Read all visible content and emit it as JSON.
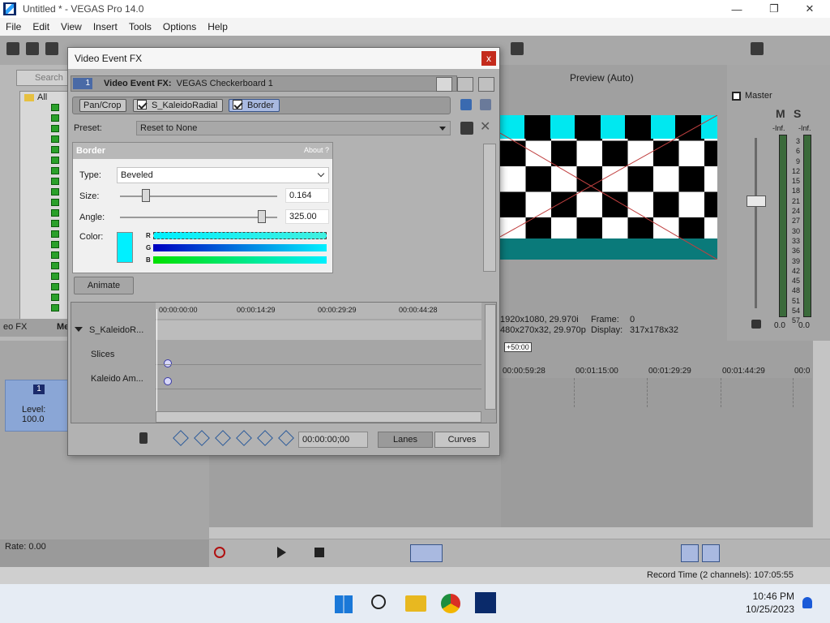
{
  "window": {
    "title": "Untitled * - VEGAS Pro 14.0",
    "minimize": "—",
    "restore": "❐",
    "close": "✕"
  },
  "menu": [
    "File",
    "Edit",
    "View",
    "Insert",
    "Tools",
    "Options",
    "Help"
  ],
  "explorer": {
    "search_placeholder": "Search",
    "root": "All",
    "tab1": "eo FX",
    "tab2": "Me"
  },
  "track": {
    "number": "1",
    "level": "Level: 100.0"
  },
  "rate": "Rate: 0.00",
  "preview": {
    "mode": "Preview (Auto)",
    "project": "1920x1080, 29.970i",
    "preview_res": "480x270x32, 29.970p",
    "frame_label": "Frame:",
    "frame_value": "0",
    "display_label": "Display:",
    "display_value": "317x178x32"
  },
  "mixer": {
    "title": "Master",
    "m": "M",
    "s": "S",
    "inf_left": "-Inf.",
    "inf_right": "-Inf.",
    "scale": [
      "3",
      "6",
      "9",
      "12",
      "15",
      "18",
      "21",
      "24",
      "27",
      "30",
      "33",
      "36",
      "39",
      "42",
      "45",
      "48",
      "51",
      "54",
      "57"
    ],
    "val_left": "0.0",
    "val_right": "0.0"
  },
  "timeline": {
    "marker": "+50:00",
    "ruler": [
      "00:00:59:28",
      "00:01:15:00",
      "00:01:29:29",
      "00:01:44:29",
      "00:0"
    ]
  },
  "status": {
    "record_time": "Record Time (2 channels): 107:05:55"
  },
  "taskbar": {
    "time": "10:46 PM",
    "date": "10/25/2023"
  },
  "dialog": {
    "title": "Video Event FX",
    "close": "x",
    "badge": "1",
    "fx_title_prefix": "Video Event FX:",
    "fx_title_name": "VEGAS Checkerboard 1",
    "chain": [
      {
        "label": "Pan/Crop",
        "checked": false,
        "active": false
      },
      {
        "label": "S_KaleidoRadial",
        "checked": true,
        "active": false
      },
      {
        "label": "Border",
        "checked": true,
        "active": true
      }
    ],
    "preset_label": "Preset:",
    "preset_value": "Reset to None",
    "plugin_name": "Border",
    "about": "About   ?",
    "type_label": "Type:",
    "type_value": "Beveled",
    "size_label": "Size:",
    "size_value": "0.164",
    "size_fraction": 0.164,
    "angle_label": "Angle:",
    "angle_value": "325.00",
    "angle_fraction": 0.9,
    "color_label": "Color:",
    "color_hex": "#00f0ff",
    "ch_r": "R",
    "ch_g": "G",
    "ch_b": "B",
    "animate": "Animate",
    "kf_ruler": [
      "00:00:00:00",
      "00:00:14:29",
      "00:00:29:29",
      "00:00:44:28"
    ],
    "kf_tracks": [
      "S_KaleidoR...",
      "Slices",
      "Kaleido Am..."
    ],
    "time_value": "00:00:00;00",
    "lanes": "Lanes",
    "curves": "Curves"
  }
}
